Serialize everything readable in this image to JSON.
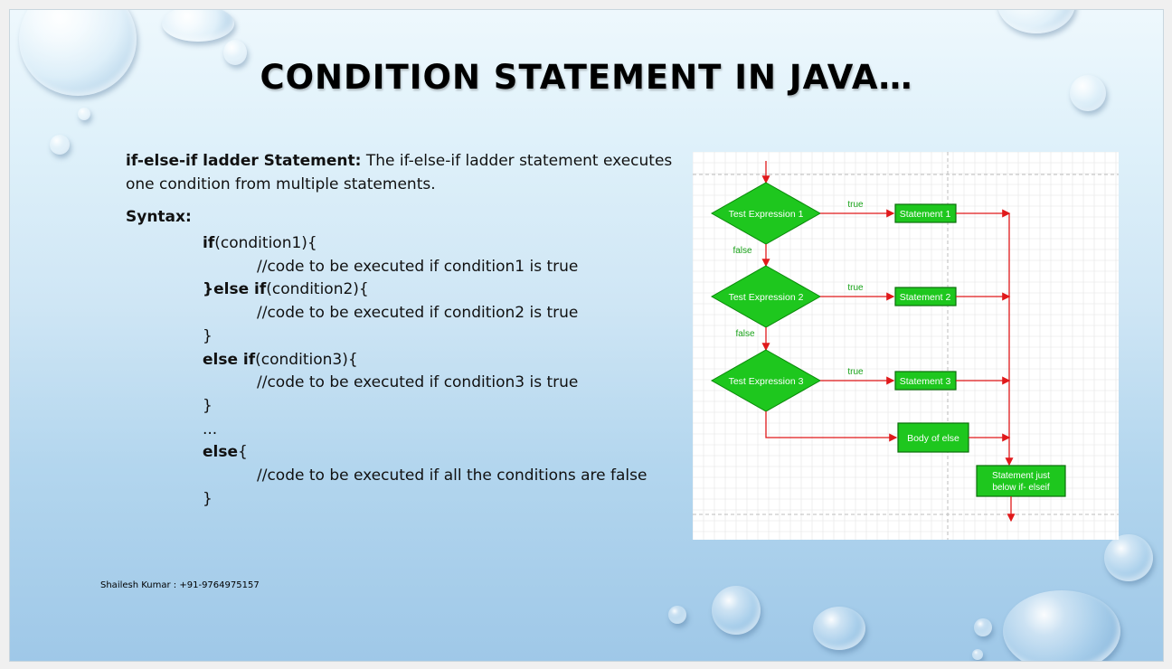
{
  "slide": {
    "title": "CONDITION STATEMENT IN JAVA…",
    "intro_bold": "if-else-if ladder Statement:",
    "intro_text": " The if-else-if ladder statement executes one condition from multiple statements.",
    "syntax_label": "Syntax:",
    "code_lines": [
      {
        "kw": "if",
        "rest": "(condition1){",
        "level": 0
      },
      {
        "kw": "",
        "rest": "//code to be executed if condition1 is true",
        "level": 1
      },
      {
        "kw": "}else if",
        "rest": "(condition2){",
        "level": 0
      },
      {
        "kw": "",
        "rest": "//code to be executed if condition2 is true",
        "level": 1
      },
      {
        "kw": "",
        "rest": "}",
        "level": 0
      },
      {
        "kw": "else if",
        "rest": "(condition3){",
        "level": 0
      },
      {
        "kw": "",
        "rest": "//code to be executed if condition3 is true",
        "level": 1
      },
      {
        "kw": "",
        "rest": "}",
        "level": 0
      },
      {
        "kw": "",
        "rest": "...",
        "level": 0
      },
      {
        "kw": "else",
        "rest": "{",
        "level": 0
      },
      {
        "kw": "",
        "rest": "//code to be executed if all the conditions are false",
        "level": 1
      },
      {
        "kw": "",
        "rest": "}",
        "level": 0
      }
    ],
    "footer": "Shailesh Kumar : +91-9764975157"
  },
  "flowchart": {
    "tests": [
      "Test Expression 1",
      "Test Expression 2",
      "Test Expression 3"
    ],
    "statements": [
      "Statement 1",
      "Statement 2",
      "Statement 3"
    ],
    "true_label": "true",
    "false_label": "false",
    "else_body": "Body of else",
    "final_line1": "Statement just",
    "final_line2": "below if- elseif",
    "colors": {
      "shape_fill": "#1ec71e",
      "shape_stroke": "#0a8a0a",
      "arrow": "#e0191b",
      "label": "#1aa31a",
      "grid": "#e4e4e4"
    }
  }
}
